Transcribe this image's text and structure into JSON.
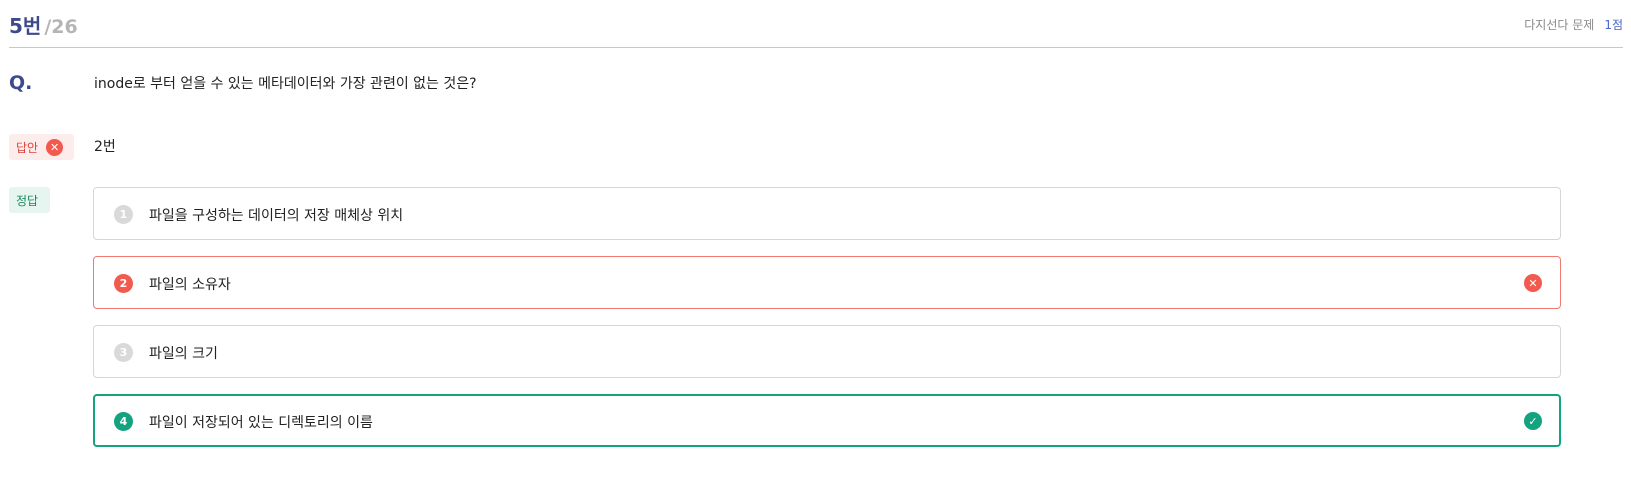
{
  "header": {
    "question_number": "5번",
    "total": "/26",
    "question_type": "다지선다 문제",
    "score": "1점"
  },
  "question": {
    "label": "Q.",
    "text": "inode로 부터 얻을 수 있는 메타데이터와 가장 관련이 없는 것은?"
  },
  "my_answer": {
    "badge_label": "답안",
    "value": "2번",
    "status_icon": "x-circle-icon"
  },
  "correct_answer": {
    "badge_label": "정답"
  },
  "options": [
    {
      "num": "1",
      "text": "파일을 구성하는 데이터의 저장 매체상 위치",
      "state": "none"
    },
    {
      "num": "2",
      "text": "파일의 소유자",
      "state": "wrong"
    },
    {
      "num": "3",
      "text": "파일의 크기",
      "state": "none"
    },
    {
      "num": "4",
      "text": "파일이 저장되어 있는 디렉토리의 이름",
      "state": "correct"
    }
  ],
  "colors": {
    "accent": "#3d4a8c",
    "wrong": "#f2594f",
    "correct": "#14a37f"
  }
}
